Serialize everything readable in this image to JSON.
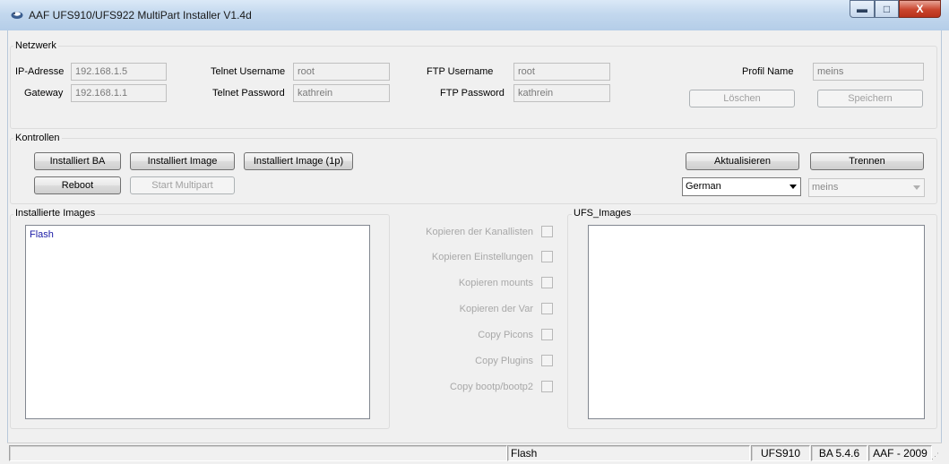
{
  "window": {
    "title": "AAF UFS910/UFS922 MultiPart Installer V1.4d",
    "minimize_glyph": "▬",
    "maximize_glyph": "□",
    "close_glyph": "X"
  },
  "network": {
    "group_title": "Netzwerk",
    "ip_label": "IP-Adresse",
    "ip_value": "192.168.1.5",
    "gateway_label": "Gateway",
    "gateway_value": "192.168.1.1",
    "telnet_user_label": "Telnet Username",
    "telnet_user_value": "root",
    "telnet_pass_label": "Telnet Password",
    "telnet_pass_value": "kathrein",
    "ftp_user_label": "FTP Username",
    "ftp_user_value": "root",
    "ftp_pass_label": "FTP Password",
    "ftp_pass_value": "kathrein",
    "profile_label": "Profil Name",
    "profile_value": "meins",
    "delete_button": "Löschen",
    "save_button": "Speichern"
  },
  "controls": {
    "group_title": "Kontrollen",
    "install_ba": "Installiert BA",
    "install_image": "Installiert Image",
    "install_image_1p": "Installiert Image (1p)",
    "reboot": "Reboot",
    "start_multipart": "Start Multipart",
    "refresh": "Aktualisieren",
    "disconnect": "Trennen",
    "language_selected": "German",
    "profile_selected": "meins"
  },
  "installed_images": {
    "group_title": "Installierte Images",
    "items": [
      "Flash"
    ]
  },
  "copy_options": [
    {
      "label": "Kopieren der Kanallisten",
      "checked": false
    },
    {
      "label": "Kopieren  Einstellungen",
      "checked": false
    },
    {
      "label": "Kopieren mounts",
      "checked": false
    },
    {
      "label": "Kopieren  der  Var",
      "checked": false
    },
    {
      "label": "Copy Picons",
      "checked": false
    },
    {
      "label": "Copy Plugins",
      "checked": false
    },
    {
      "label": "Copy bootp/bootp2",
      "checked": false
    }
  ],
  "ufs_images": {
    "group_title": "UFS_Images",
    "items": []
  },
  "statusbar": {
    "left": "",
    "image": "Flash",
    "model": "UFS910",
    "ba_version": "BA 5.4.6",
    "copyright": "AAF - 2009"
  },
  "colors": {
    "window_bg": "#f0f0f0",
    "list_text": "#1a1aa6",
    "disabled_text": "#a0a0a0"
  }
}
